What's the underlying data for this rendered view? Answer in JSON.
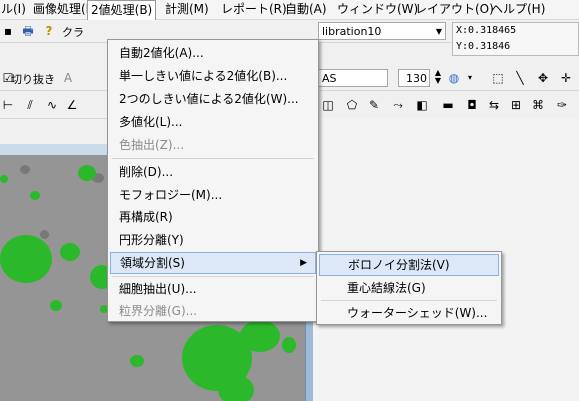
{
  "menubar": {
    "items": [
      {
        "label": "ル(I)"
      },
      {
        "label": "画像処理(I)"
      },
      {
        "label": "2値処理(B)"
      },
      {
        "label": "計測(M)"
      },
      {
        "label": "レポート(R)"
      },
      {
        "label": "自動(A)"
      },
      {
        "label": "ウィンドウ(W)"
      },
      {
        "label": "レイアウト(O)"
      },
      {
        "label": "ヘルプ(H)"
      }
    ]
  },
  "toolbar": {
    "class_label": "クラ",
    "cut_label": "切り抜き",
    "calibration_value": "libration10",
    "coord_readout": "X:0.318465 Y:0.31846",
    "font_name": "AS",
    "font_size": "130"
  },
  "dropdown": {
    "items": [
      {
        "label": "自動2値化(A)..."
      },
      {
        "label": "単一しきい値による2値化(B)..."
      },
      {
        "label": "2つのしきい値による2値化(W)..."
      },
      {
        "label": "多値化(L)..."
      },
      {
        "label": "色抽出(Z)..."
      },
      {
        "label": "削除(D)..."
      },
      {
        "label": "モフォロジー(M)..."
      },
      {
        "label": "再構成(R)"
      },
      {
        "label": "円形分離(Y)"
      },
      {
        "label": "領域分割(S)"
      },
      {
        "label": "細胞抽出(U)..."
      },
      {
        "label": "粒界分離(G)..."
      }
    ]
  },
  "submenu": {
    "items": [
      {
        "label": "ボロノイ分割法(V)"
      },
      {
        "label": "重心結線法(G)"
      },
      {
        "label": "ウォーターシェッド(W)..."
      }
    ]
  },
  "colors": {
    "menu_highlight": "#dce8f7",
    "cell_green": "#2bb82b",
    "disabled_text": "#8c8c8c"
  }
}
